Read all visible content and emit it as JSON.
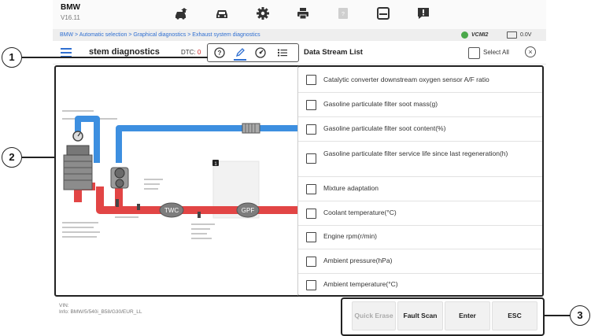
{
  "header": {
    "brand": "BMW",
    "version": "V16.11"
  },
  "breadcrumb": "BMW > Automatic selection > Graphical diagnostics > Exhaust system diagnostics",
  "status": {
    "vci": "VCMI2",
    "voltage": "0.0V"
  },
  "title_row": {
    "page_title": "stem diagnostics",
    "dtc_label": "DTC:",
    "dtc_count": "0",
    "data_stream_title": "Data Stream List",
    "select_all": "Select All"
  },
  "callouts": [
    "1",
    "2",
    "3"
  ],
  "diagram": {
    "twc_label": "TWC",
    "gpf_label": "GPF",
    "badge": "1"
  },
  "data_stream_items": [
    "Catalytic converter downstream oxygen sensor A/F ratio",
    "Gasoline particulate filter soot mass(g)",
    "Gasoline particulate filter soot content(%)",
    "Gasoline particulate filter service life since last regeneration(h)",
    "Mixture adaptation",
    "Coolant temperature(°C)",
    "Engine rpm(r/min)",
    "Ambient pressure(hPa)",
    "Ambient temperature(°C)"
  ],
  "footer": {
    "vin_label": "VIN:",
    "info": "Info: BMW/5/540i_B58/G30/EUR_LL"
  },
  "buttons": {
    "quick_erase": "Quick Erase",
    "fault_scan": "Fault Scan",
    "enter": "Enter",
    "esc": "ESC"
  },
  "colors": {
    "accent": "#2f6fd1",
    "pipe_blue": "#3d8fe0",
    "pipe_red": "#e24545",
    "dtc_red": "#d21f1f"
  }
}
